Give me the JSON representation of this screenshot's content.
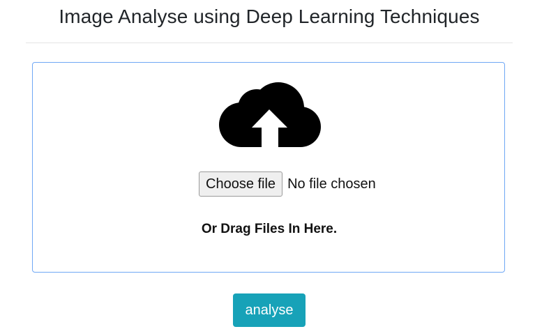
{
  "header": {
    "title": "Image Analyse using Deep Learning Techniques"
  },
  "upload": {
    "icon": "cloud-upload-icon",
    "choose_file_label": "Choose file",
    "file_status": "No file chosen",
    "drag_text": "Or Drag Files In Here."
  },
  "actions": {
    "analyse_label": "analyse"
  },
  "colors": {
    "title_text": "#212529",
    "dropzone_border": "#6fa7f5",
    "analyse_button": "#17a2b8",
    "analyse_text": "#ffffff",
    "icon": "#000000"
  }
}
